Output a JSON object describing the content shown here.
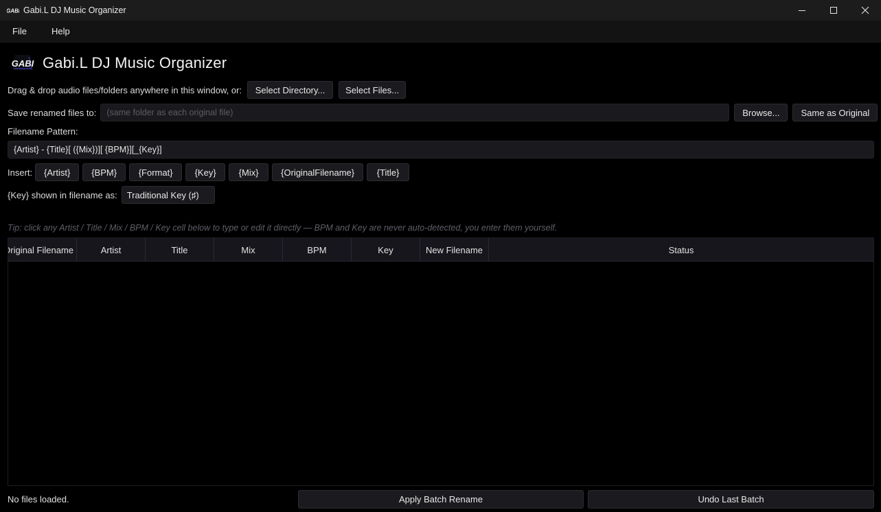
{
  "window": {
    "title": "Gabi.L DJ Music Organizer",
    "controls": [
      "minimize-icon",
      "maximize-icon",
      "close-icon"
    ]
  },
  "menu": {
    "items": [
      {
        "label": "File"
      },
      {
        "label": "Help"
      }
    ]
  },
  "header": {
    "logo_text": "GABI",
    "title": "Gabi.L DJ Music Organizer"
  },
  "source": {
    "label": "Drag & drop audio files/folders anywhere in this window, or:",
    "select_directory": "Select Directory...",
    "select_files": "Select Files..."
  },
  "save": {
    "label": "Save renamed files to:",
    "placeholder": "(same folder as each original file)",
    "browse": "Browse...",
    "same_as_original": "Same as Original"
  },
  "pattern": {
    "label": "Filename Pattern:",
    "value": "{Artist} - {Title}[ ({Mix})][ {BPM}][_{Key}]"
  },
  "insert": {
    "label": "Insert:",
    "tokens": [
      "{Artist}",
      "{BPM}",
      "{Format}",
      "{Key}",
      "{Mix}",
      "{OriginalFilename}",
      "{Title}"
    ]
  },
  "key_display": {
    "label": "{Key} shown in filename as:",
    "value": "Traditional Key (♯)"
  },
  "tip": "Tip: click any Artist / Title / Mix / BPM / Key cell below to type or edit it directly — BPM and Key are never auto-detected, you enter them yourself.",
  "table": {
    "columns": [
      "Original Filename",
      "Artist",
      "Title",
      "Mix",
      "BPM",
      "Key",
      "New Filename",
      "Status"
    ],
    "rows": []
  },
  "footer": {
    "status": "No files loaded.",
    "apply": "Apply Batch Rename",
    "undo": "Undo Last Batch"
  }
}
